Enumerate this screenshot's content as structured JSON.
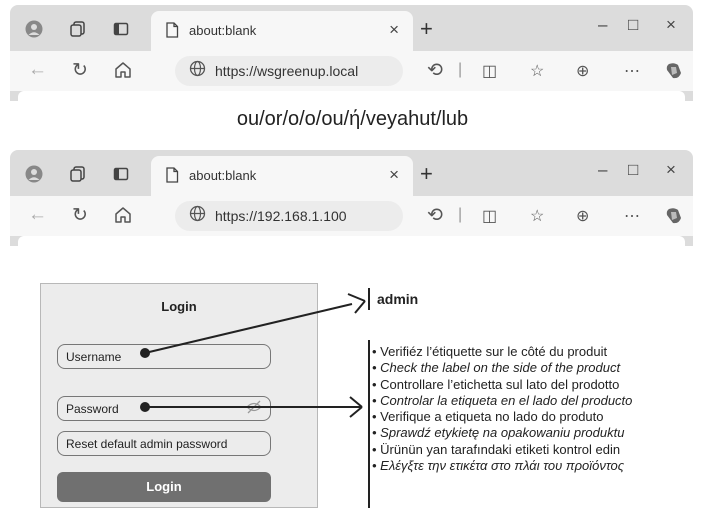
{
  "browsers": [
    {
      "tab_title": "about:blank",
      "url": "https://wsgreenup.local"
    },
    {
      "tab_title": "about:blank",
      "url": "https://192.168.1.100"
    }
  ],
  "browser_ui": {
    "tab_close": "×",
    "new_tab": "+",
    "minimize": "–",
    "maximize": "□",
    "close": "×"
  },
  "icons": {
    "profile": "profile-icon",
    "collections": "collections-icon",
    "tab_actions": "tab-actions-icon",
    "page": "page-icon",
    "back": "back-arrow-icon",
    "refresh": "refresh-icon",
    "home": "home-icon",
    "globe": "globe-icon",
    "extensions": "extensions-icon",
    "split_screen": "split-screen-icon",
    "favorites": "favorites-icon",
    "collections_toolbar": "collections-toolbar-icon",
    "more": "more-icon",
    "copilot": "copilot-icon",
    "eye_hidden": "eye-hidden-icon"
  },
  "caption": "ou/or/o/o/ou/ή/veyahut/lub",
  "login": {
    "title": "Login",
    "username_label": "Username",
    "password_label": "Password",
    "reset_label": "Reset default admin password",
    "button_label": "Login"
  },
  "credential": {
    "username": "admin"
  },
  "instructions": [
    {
      "text": "• Verifiéz l’étiquette sur le côté du produit",
      "italic": false
    },
    {
      "text": "• Check the label on the side of the product",
      "italic": true
    },
    {
      "text": "• Controllare l’etichetta sul lato del prodotto",
      "italic": false
    },
    {
      "text": "• Controlar la etiqueta en el lado del producto",
      "italic": true
    },
    {
      "text": "• Verifique a etiqueta no lado do produto",
      "italic": false
    },
    {
      "text": "• Sprawdź etykietę na opakowaniu produktu",
      "italic": true
    },
    {
      "text": "• Ürünün yan tarafındaki etiketi kontrol edin",
      "italic": false
    },
    {
      "text": "• Ελέγξτε την ετικέτα στο πλάι του προϊόντος",
      "italic": true
    }
  ],
  "colors": {
    "chrome": "#dcdcdc",
    "tab": "#f7f7f7",
    "panel": "#ececec",
    "button": "#707070",
    "ink": "#222222"
  }
}
